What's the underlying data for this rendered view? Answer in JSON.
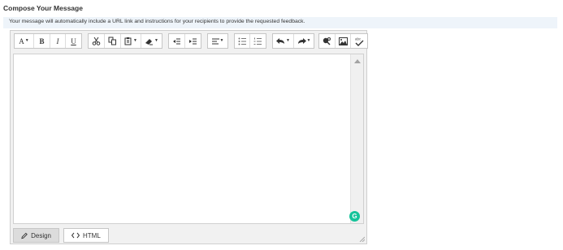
{
  "section": {
    "title": "Compose Your Message"
  },
  "info": {
    "text": "Your message will automatically include a URL link and instructions for your recipients to provide the requested feedback."
  },
  "toolbar": {
    "font_size_label": "A",
    "bold_label": "B",
    "italic_label": "I",
    "underline_label": "U",
    "spellcheck_label": "abc"
  },
  "editor": {
    "body_text": "",
    "grammarly_label": "G",
    "modes": [
      {
        "label": "Design",
        "icon": "pencil-icon",
        "active": true
      },
      {
        "label": "HTML",
        "icon": "code-icon",
        "active": false
      }
    ]
  },
  "colors": {
    "info_bar": "#eef4fa",
    "grammarly": "#15c39a",
    "editor_bg": "#f1f1f1"
  }
}
